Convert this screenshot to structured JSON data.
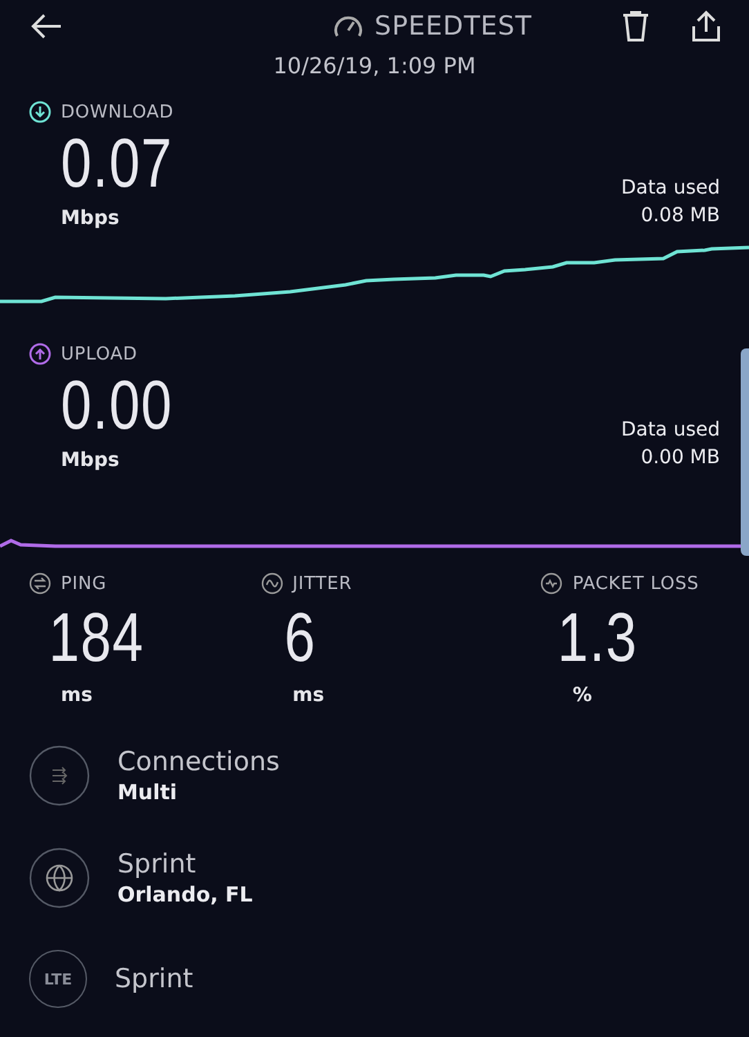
{
  "header": {
    "title": "SPEEDTEST",
    "timestamp": "10/26/19, 1:09 PM"
  },
  "speeds": [
    {
      "kind": "download",
      "label": "DOWNLOAD",
      "value": "0.07",
      "unit": "Mbps",
      "data_label": "Data used",
      "data_value": "0.08 MB",
      "color": "#6fe3d4"
    },
    {
      "kind": "upload",
      "label": "UPLOAD",
      "value": "0.00",
      "unit": "Mbps",
      "data_label": "Data used",
      "data_value": "0.00 MB",
      "color": "#b06be8"
    }
  ],
  "stats": [
    {
      "kind": "ping",
      "label": "PING",
      "value": "184",
      "unit": "ms"
    },
    {
      "kind": "jitter",
      "label": "JITTER",
      "value": "6",
      "unit": "ms"
    },
    {
      "kind": "packet_loss",
      "label": "PACKET LOSS",
      "value": "1.3",
      "unit": "%"
    }
  ],
  "info": [
    {
      "kind": "connections",
      "title": "Connections",
      "detail": "Multi"
    },
    {
      "kind": "server",
      "title": "Sprint",
      "detail": "Orlando, FL"
    },
    {
      "kind": "network",
      "badge": "LTE",
      "title": "Sprint"
    }
  ]
}
